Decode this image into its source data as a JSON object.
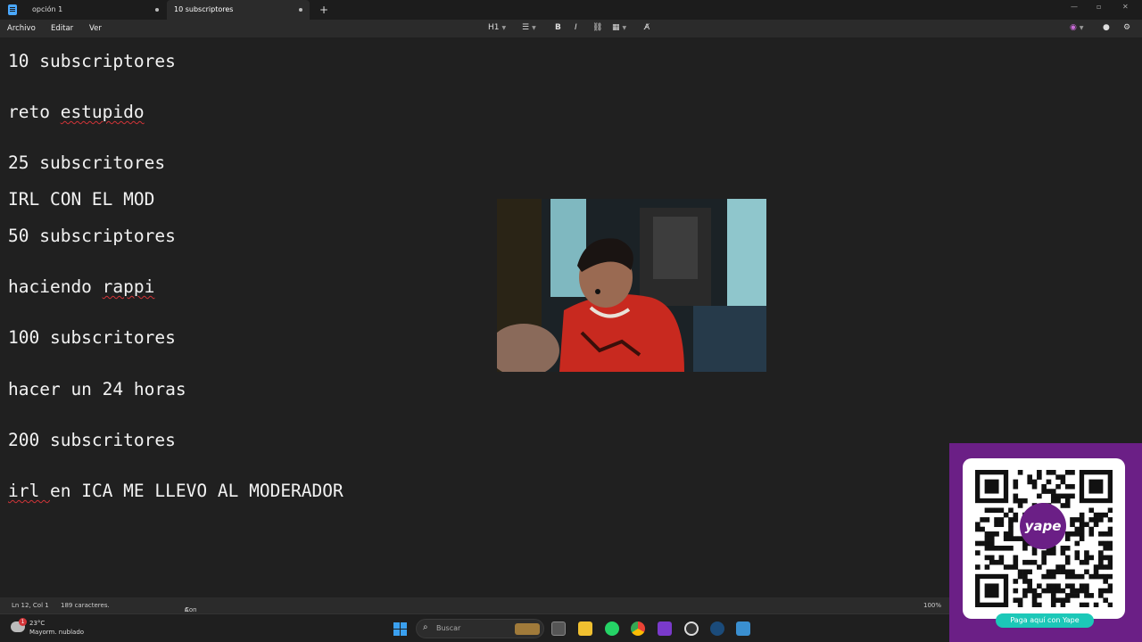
{
  "tabs": [
    {
      "label": "opción 1",
      "modified": true
    },
    {
      "label": "10 subscriptores",
      "modified": true,
      "active": true
    }
  ],
  "menu": {
    "file": "Archivo",
    "edit": "Editar",
    "view": "Ver"
  },
  "toolbar": {
    "heading": "H1"
  },
  "document": {
    "lines": [
      "10 subscriptores",
      "reto estupido",
      "25 subscritores",
      "IRL CON EL MOD",
      "50 subscriptores",
      "haciendo rappi",
      "100 subscritores",
      "hacer un 24 horas",
      "200 subscritores",
      "irl en ICA ME LLEVO AL MODERADOR"
    ]
  },
  "status": {
    "position": "Ln 12, Col 1",
    "chars": "189 caracteres.",
    "format": "Con formato",
    "zoom": "100%"
  },
  "taskbar": {
    "weather_temp": "23°C",
    "weather_desc": "Mayorm. nublado",
    "search_placeholder": "Buscar"
  },
  "overlay": {
    "yape_button": "Paga aquí con Yape",
    "logo_text": "yape"
  },
  "colors": {
    "yape_purple": "#6b1f86",
    "yape_teal": "#1cc8b8",
    "spell_error": "#d13438"
  }
}
